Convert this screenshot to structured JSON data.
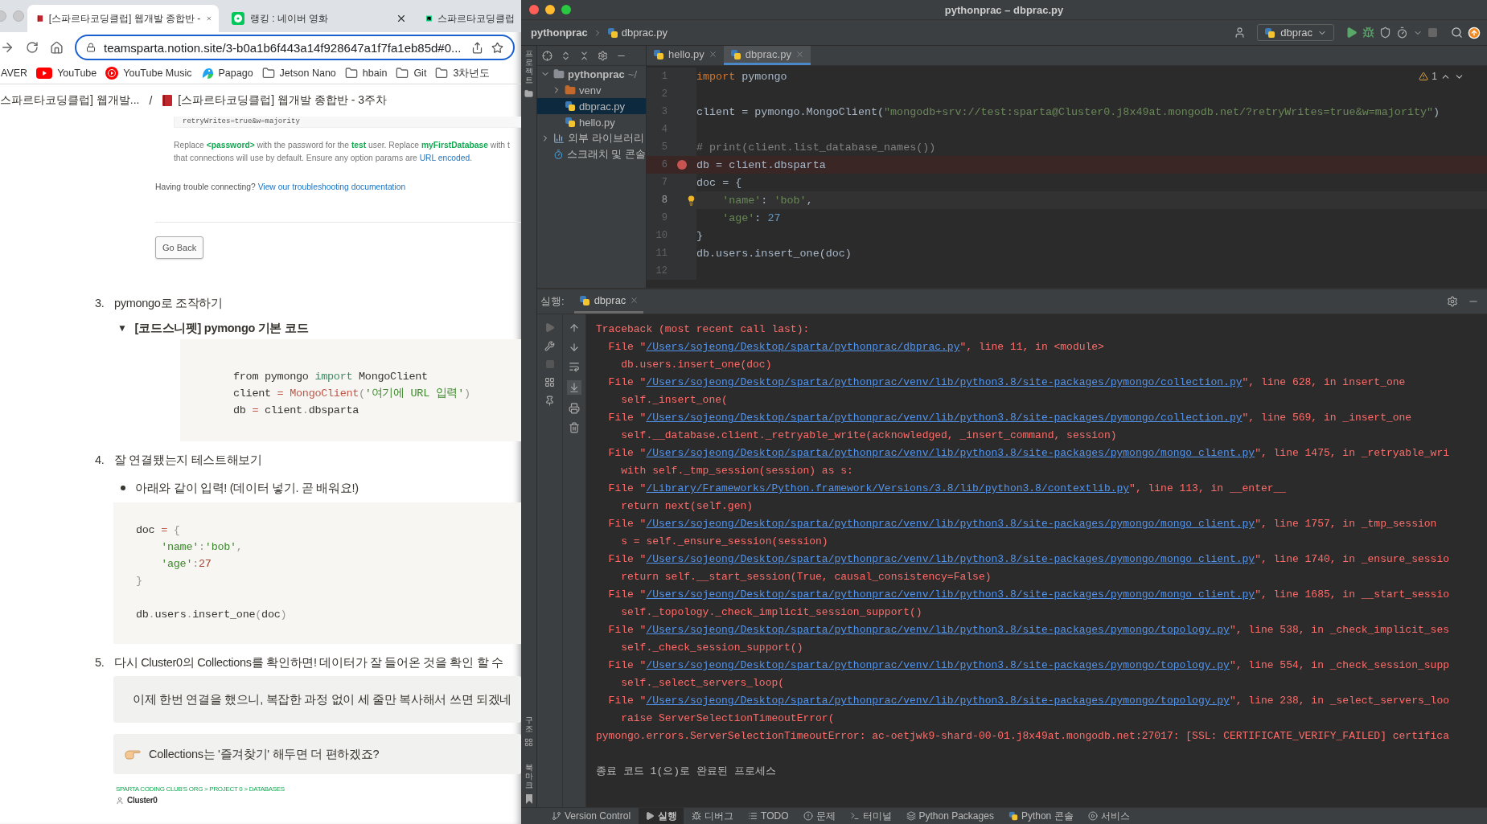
{
  "browser": {
    "tabs": [
      {
        "title": "[스파르타코딩클럽] 웹개발 종합반 -",
        "kind": "book",
        "selected": true,
        "closable": true
      },
      {
        "title": "랭킹 : 네이버 영화",
        "kind": "naver",
        "selected": false,
        "closable": true
      },
      {
        "title": "스파르타코딩클럽",
        "kind": "ide",
        "selected": false,
        "closable": false
      }
    ],
    "address": {
      "url": "teamsparta.notion.site/3-b0a1b6f443a14f928647a1f7fa1eb85d#0..."
    },
    "bookmarks": [
      {
        "label": "AVER",
        "kind": "plain"
      },
      {
        "label": "YouTube",
        "kind": "youtube"
      },
      {
        "label": "YouTube Music",
        "kind": "music"
      },
      {
        "label": "Papago",
        "kind": "papago"
      },
      {
        "label": "Jetson Nano",
        "kind": "folder"
      },
      {
        "label": "hbain",
        "kind": "folder"
      },
      {
        "label": "Git",
        "kind": "folder"
      },
      {
        "label": "3차년도",
        "kind": "folder"
      }
    ],
    "page": {
      "breadcrumb": [
        "스파르타코딩클럽] 웹개발...",
        "[스파르타코딩클럽] 웹개발 종합반 - 3주차"
      ],
      "separator": "/",
      "connection": {
        "code": "retryWrites=true&w=majority",
        "note": [
          "Replace **<password>** with the password for the **test** user. Replace **myFirstDatabase** with t"
        ],
        "note_tail": {
          "text": "that connections will use by default. Ensure any option params are ",
          "link": "URL encoded",
          "after": "."
        },
        "trouble": {
          "text": "Having trouble connecting? ",
          "link": "View our troubleshooting documentation"
        },
        "button": "Go Back"
      },
      "blocks": [
        {
          "kind": "numbered",
          "number": "3.",
          "text": "pymongo로 조작하기"
        },
        {
          "kind": "toggle",
          "arrow": "▼",
          "text": "[코드스니펫] pymongo 기본 코드",
          "expanded": true,
          "code": [
            {
              "tokens": [
                {
                  "kind": "plain",
                  "text": "from pymongo "
                },
                {
                  "kind": "keyword",
                  "text": "import"
                },
                {
                  "kind": "plain",
                  "text": " MongoClient"
                }
              ]
            },
            {
              "tokens": [
                {
                  "kind": "plain",
                  "text": "client "
                },
                {
                  "kind": "op",
                  "text": "="
                },
                {
                  "kind": "func",
                  "text": " MongoClient"
                },
                {
                  "kind": "punct",
                  "text": "("
                },
                {
                  "kind": "string",
                  "text": "'여기에 URL 입력'"
                },
                {
                  "kind": "punct",
                  "text": ")"
                }
              ]
            },
            {
              "tokens": [
                {
                  "kind": "plain",
                  "text": "db "
                },
                {
                  "kind": "op",
                  "text": "="
                },
                {
                  "kind": "plain",
                  "text": " client"
                },
                {
                  "kind": "punct",
                  "text": "."
                },
                {
                  "kind": "plain",
                  "text": "dbsparta"
                }
              ]
            }
          ]
        },
        {
          "kind": "numbered",
          "number": "4.",
          "text": "잘 연결됐는지 테스트해보기"
        },
        {
          "kind": "bullet",
          "text": "아래와 같이 입력! (데이터 넣기. 곧 배워요!)"
        },
        {
          "kind": "code",
          "code": [
            {
              "tokens": [
                {
                  "kind": "plain",
                  "text": "doc "
                },
                {
                  "kind": "op",
                  "text": "="
                },
                {
                  "kind": "punct",
                  "text": " {"
                }
              ]
            },
            {
              "tokens": [
                {
                  "kind": "string",
                  "text": "    'name'"
                },
                {
                  "kind": "punct",
                  "text": ":"
                },
                {
                  "kind": "string",
                  "text": "'bob'"
                },
                {
                  "kind": "punct",
                  "text": ","
                }
              ]
            },
            {
              "tokens": [
                {
                  "kind": "string",
                  "text": "    'age'"
                },
                {
                  "kind": "punct",
                  "text": ":"
                },
                {
                  "kind": "number",
                  "text": "27"
                }
              ]
            },
            {
              "tokens": [
                {
                  "kind": "punct",
                  "text": "}"
                }
              ]
            },
            {
              "blank_before": true,
              "tokens": [
                {
                  "kind": "plain",
                  "text": "db"
                },
                {
                  "kind": "punct",
                  "text": "."
                },
                {
                  "kind": "plain",
                  "text": "users"
                },
                {
                  "kind": "punct",
                  "text": "."
                },
                {
                  "kind": "plain",
                  "text": "insert_one"
                },
                {
                  "kind": "punct",
                  "text": "("
                },
                {
                  "kind": "plain",
                  "text": "doc"
                },
                {
                  "kind": "punct",
                  "text": ")"
                }
              ]
            }
          ]
        },
        {
          "kind": "numbered",
          "number": "5.",
          "text": "다시 Cluster0의 Collections를 확인하면! 데이터가 잘 들어온 것을 확인 할 수"
        },
        {
          "kind": "callout",
          "text": "이제 한번 연결을 했으니, 복잡한 과정 없이 세 줄만 복사해서 쓰면 되겠네"
        },
        {
          "kind": "callout",
          "text": "Collections는 '즐겨찾기' 해두면 더 편하겠죠?"
        },
        {
          "kind": "image",
          "caption": "SPARTA CODING CLUB'S ORG > PROJECT 0 > DATABASES",
          "title": "Cluster0"
        }
      ]
    }
  },
  "ide": {
    "title": "pythonprac – dbprac.py",
    "breadcrumb": [
      "pythonprac",
      "dbprac.py"
    ],
    "run_config": "dbprac",
    "side_labels": {
      "top": "프로젝트",
      "bottom": [
        "구조",
        "북마크"
      ]
    },
    "project": {
      "items": [
        {
          "name": "pythonprac",
          "path": "~/",
          "kind": "folder",
          "expanded": true,
          "selected": false,
          "children": [
            {
              "name": "venv",
              "kind": "excluded",
              "expanded": false,
              "selected": false
            },
            {
              "name": "dbprac.py",
              "kind": "python",
              "selected": true
            },
            {
              "name": "hello.py",
              "kind": "python",
              "selected": false
            }
          ]
        },
        {
          "name": "외부 라이브러리",
          "kind": "library",
          "expanded": false,
          "selected": false
        },
        {
          "name": "스크래치 및 콘솔",
          "kind": "scratch",
          "selected": false
        }
      ]
    },
    "editor": {
      "tabs": [
        {
          "label": "hello.py",
          "selected": false
        },
        {
          "label": "dbprac.py",
          "selected": true
        }
      ],
      "warnings": "1",
      "lines": [
        {
          "n": "1",
          "breakpoint": false,
          "current": false,
          "tokens": [
            {
              "kind": "keyword",
              "text": "import"
            },
            {
              "kind": "plain",
              "text": " pymongo"
            }
          ]
        },
        {
          "n": "2",
          "breakpoint": false,
          "current": false
        },
        {
          "n": "3",
          "breakpoint": false,
          "current": false,
          "tokens": [
            {
              "kind": "plain",
              "text": "client = pymongo.MongoClient("
            },
            {
              "kind": "string",
              "text": "\"mongodb+srv://test:sparta@Cluster0.j8x49at.mongodb.net/?retryWrites=true&w=majority\""
            },
            {
              "kind": "plain",
              "text": ")"
            }
          ]
        },
        {
          "n": "4",
          "breakpoint": false,
          "current": false
        },
        {
          "n": "5",
          "breakpoint": false,
          "current": false,
          "tokens": [
            {
              "kind": "comment",
              "text": "# print(client.list_database_names())"
            }
          ]
        },
        {
          "n": "6",
          "breakpoint": true,
          "current": false,
          "tokens": [
            {
              "kind": "plain",
              "text": "db = client.dbsparta"
            }
          ]
        },
        {
          "n": "7",
          "breakpoint": false,
          "current": false,
          "tokens": [
            {
              "kind": "plain",
              "text": "doc = {"
            }
          ]
        },
        {
          "n": "8",
          "breakpoint": false,
          "current": true,
          "tokens": [
            {
              "kind": "string",
              "text": "    'name'"
            },
            {
              "kind": "plain",
              "text": ": "
            },
            {
              "kind": "string",
              "text": "'bob'"
            },
            {
              "kind": "plain",
              "text": ","
            }
          ]
        },
        {
          "n": "9",
          "breakpoint": false,
          "current": false,
          "tokens": [
            {
              "kind": "string",
              "text": "    'age'"
            },
            {
              "kind": "plain",
              "text": ": "
            },
            {
              "kind": "number",
              "text": "27"
            }
          ]
        },
        {
          "n": "10",
          "breakpoint": false,
          "current": false,
          "tokens": [
            {
              "kind": "plain",
              "text": "}"
            }
          ]
        },
        {
          "n": "11",
          "breakpoint": false,
          "current": false,
          "tokens": [
            {
              "kind": "plain",
              "text": "db.users.insert_one(doc)"
            }
          ]
        },
        {
          "n": "12",
          "breakpoint": false,
          "current": false
        }
      ]
    },
    "run": {
      "label": "실행:",
      "tab": "dbprac",
      "lines": [
        {
          "kind": "header",
          "text": "Traceback (most recent call last):"
        },
        {
          "kind": "file",
          "before": "File \"",
          "path": "/Users/sojeong/Desktop/sparta/pythonprac/dbprac.py",
          "after": "\", line 11, in <module>"
        },
        {
          "kind": "code",
          "text": "db.users.insert_one(doc)"
        },
        {
          "kind": "file",
          "before": "File \"",
          "path": "/Users/sojeong/Desktop/sparta/pythonprac/venv/lib/python3.8/site-packages/pymongo/collection.py",
          "after": "\", line 628, in insert_one"
        },
        {
          "kind": "code",
          "text": "self._insert_one("
        },
        {
          "kind": "file",
          "before": "File \"",
          "path": "/Users/sojeong/Desktop/sparta/pythonprac/venv/lib/python3.8/site-packages/pymongo/collection.py",
          "after": "\", line 569, in _insert_one"
        },
        {
          "kind": "code",
          "text": "self.__database.client._retryable_write(acknowledged, _insert_command, session)"
        },
        {
          "kind": "file",
          "before": "File \"",
          "path": "/Users/sojeong/Desktop/sparta/pythonprac/venv/lib/python3.8/site-packages/pymongo/mongo_client.py",
          "after": "\", line 1475, in _retryable_wri"
        },
        {
          "kind": "code",
          "text": "with self._tmp_session(session) as s:"
        },
        {
          "kind": "file",
          "before": "File \"",
          "path": "/Library/Frameworks/Python.framework/Versions/3.8/lib/python3.8/contextlib.py",
          "after": "\", line 113, in __enter__"
        },
        {
          "kind": "code",
          "text": "return next(self.gen)"
        },
        {
          "kind": "file",
          "before": "File \"",
          "path": "/Users/sojeong/Desktop/sparta/pythonprac/venv/lib/python3.8/site-packages/pymongo/mongo_client.py",
          "after": "\", line 1757, in _tmp_session"
        },
        {
          "kind": "code",
          "text": "s = self._ensure_session(session)"
        },
        {
          "kind": "file",
          "before": "File \"",
          "path": "/Users/sojeong/Desktop/sparta/pythonprac/venv/lib/python3.8/site-packages/pymongo/mongo_client.py",
          "after": "\", line 1740, in _ensure_sessio"
        },
        {
          "kind": "code",
          "text": "return self.__start_session(True, causal_consistency=False)"
        },
        {
          "kind": "file",
          "before": "File \"",
          "path": "/Users/sojeong/Desktop/sparta/pythonprac/venv/lib/python3.8/site-packages/pymongo/mongo_client.py",
          "after": "\", line 1685, in __start_sessio"
        },
        {
          "kind": "code",
          "text": "self._topology._check_implicit_session_support()"
        },
        {
          "kind": "file",
          "before": "File \"",
          "path": "/Users/sojeong/Desktop/sparta/pythonprac/venv/lib/python3.8/site-packages/pymongo/topology.py",
          "after": "\", line 538, in _check_implicit_ses"
        },
        {
          "kind": "code",
          "text": "self._check_session_support()"
        },
        {
          "kind": "file",
          "before": "File \"",
          "path": "/Users/sojeong/Desktop/sparta/pythonprac/venv/lib/python3.8/site-packages/pymongo/topology.py",
          "after": "\", line 554, in _check_session_supp"
        },
        {
          "kind": "code",
          "text": "self._select_servers_loop("
        },
        {
          "kind": "file",
          "before": "File \"",
          "path": "/Users/sojeong/Desktop/sparta/pythonprac/venv/lib/python3.8/site-packages/pymongo/topology.py",
          "after": "\", line 238, in _select_servers_loo"
        },
        {
          "kind": "code",
          "text": "raise ServerSelectionTimeoutError("
        },
        {
          "kind": "error",
          "text": "pymongo.errors.ServerSelectionTimeoutError: ac-oetjwk9-shard-00-01.j8x49at.mongodb.net:27017: [SSL: CERTIFICATE_VERIFY_FAILED] certifica"
        }
      ],
      "exit": "종료 코드 1(으)로 완료된 프로세스"
    },
    "status_bar": [
      {
        "label": "Version Control",
        "kind": "vcs",
        "selected": false
      },
      {
        "label": "실행",
        "kind": "run",
        "selected": true
      },
      {
        "label": "디버그",
        "kind": "debug",
        "selected": false
      },
      {
        "label": "TODO",
        "kind": "list",
        "selected": false
      },
      {
        "label": "문제",
        "kind": "problem",
        "selected": false
      },
      {
        "label": "터미널",
        "kind": "terminal",
        "selected": false
      },
      {
        "label": "Python Packages",
        "kind": "packages",
        "selected": false
      },
      {
        "label": "Python 콘솔",
        "kind": "python",
        "selected": false
      },
      {
        "label": "서비스",
        "kind": "services",
        "selected": false
      }
    ]
  }
}
